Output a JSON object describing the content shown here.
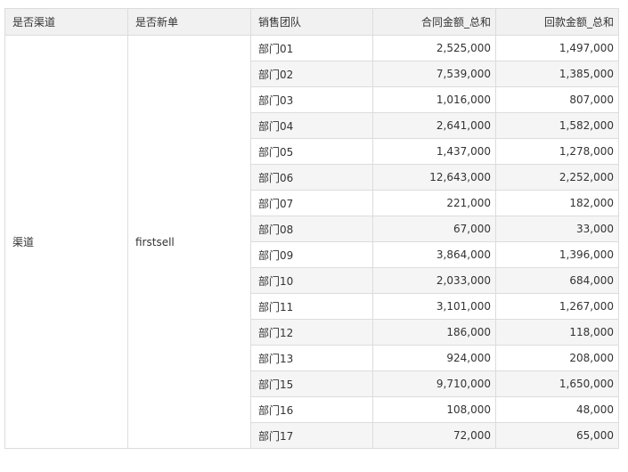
{
  "table": {
    "columns": [
      "是否渠道",
      "是否新单",
      "销售团队",
      "合同金额_总和",
      "回款金额_总和"
    ],
    "group": {
      "channel": "渠道",
      "new_order": "firstsell"
    },
    "rows": [
      {
        "team": "部门01",
        "contract": "2,525,000",
        "payment": "1,497,000"
      },
      {
        "team": "部门02",
        "contract": "7,539,000",
        "payment": "1,385,000"
      },
      {
        "team": "部门03",
        "contract": "1,016,000",
        "payment": "807,000"
      },
      {
        "team": "部门04",
        "contract": "2,641,000",
        "payment": "1,582,000"
      },
      {
        "team": "部门05",
        "contract": "1,437,000",
        "payment": "1,278,000"
      },
      {
        "team": "部门06",
        "contract": "12,643,000",
        "payment": "2,252,000"
      },
      {
        "team": "部门07",
        "contract": "221,000",
        "payment": "182,000"
      },
      {
        "team": "部门08",
        "contract": "67,000",
        "payment": "33,000"
      },
      {
        "team": "部门09",
        "contract": "3,864,000",
        "payment": "1,396,000"
      },
      {
        "team": "部门10",
        "contract": "2,033,000",
        "payment": "684,000"
      },
      {
        "team": "部门11",
        "contract": "3,101,000",
        "payment": "1,267,000"
      },
      {
        "team": "部门12",
        "contract": "186,000",
        "payment": "118,000"
      },
      {
        "team": "部门13",
        "contract": "924,000",
        "payment": "208,000"
      },
      {
        "team": "部门15",
        "contract": "9,710,000",
        "payment": "1,650,000"
      },
      {
        "team": "部门16",
        "contract": "108,000",
        "payment": "48,000"
      },
      {
        "team": "部门17",
        "contract": "72,000",
        "payment": "65,000"
      }
    ]
  }
}
